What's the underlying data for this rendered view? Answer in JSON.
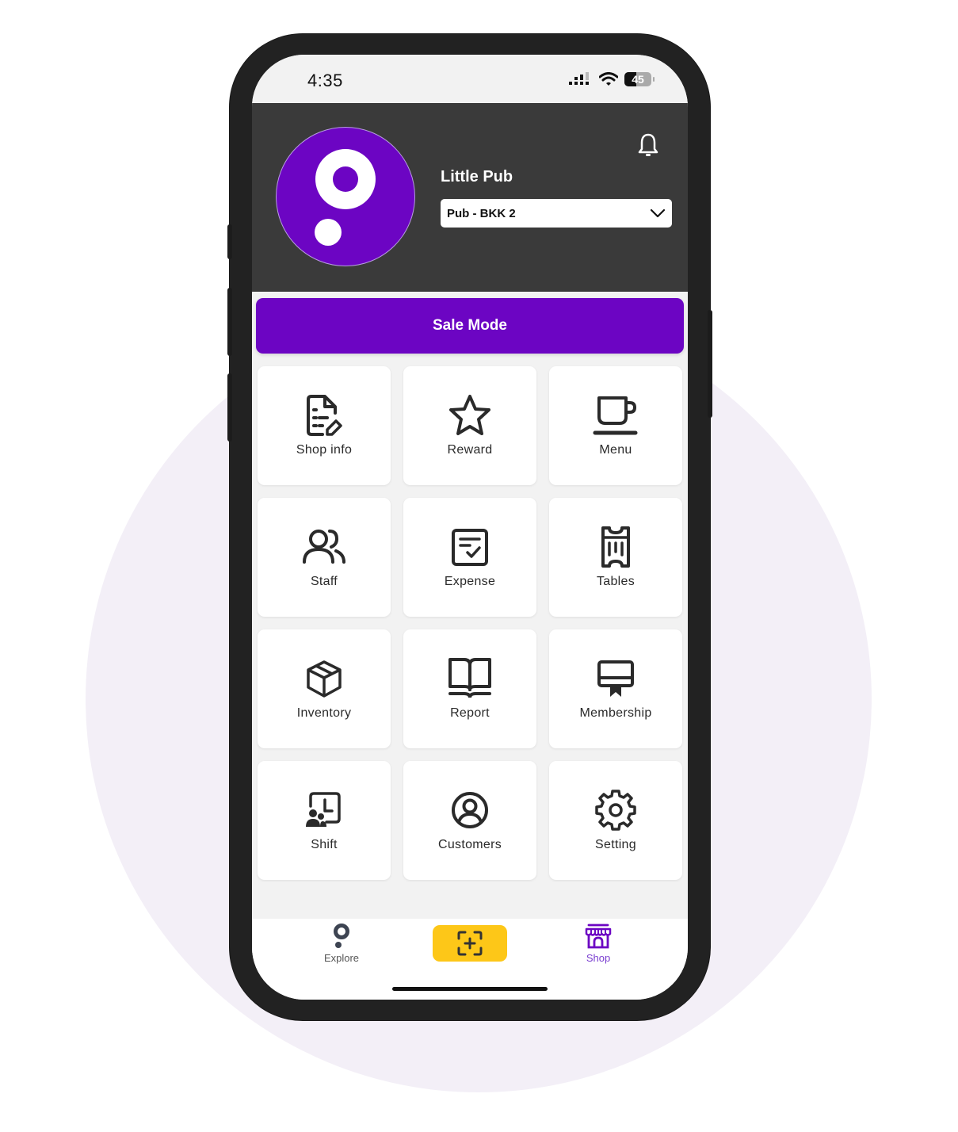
{
  "status_bar": {
    "time": "4:35",
    "battery_level": "45",
    "icons": [
      "cellular-signal-icon",
      "wifi-icon",
      "battery-icon"
    ]
  },
  "header": {
    "shop_name": "Little Pub",
    "branch_selected": "Pub - BKK 2",
    "logo_icon": "pin-logo-icon",
    "notification_icon": "bell-icon"
  },
  "sale_mode": {
    "label": "Sale Mode"
  },
  "menu_tiles": [
    {
      "label": "Shop info",
      "icon": "document-edit-icon"
    },
    {
      "label": "Reward",
      "icon": "star-icon"
    },
    {
      "label": "Menu",
      "icon": "coffee-cup-icon"
    },
    {
      "label": "Staff",
      "icon": "users-icon"
    },
    {
      "label": "Expense",
      "icon": "checklist-icon"
    },
    {
      "label": "Tables",
      "icon": "ticket-icon"
    },
    {
      "label": "Inventory",
      "icon": "box-icon"
    },
    {
      "label": "Report",
      "icon": "open-book-icon"
    },
    {
      "label": "Membership",
      "icon": "membership-card-icon"
    },
    {
      "label": "Shift",
      "icon": "shift-clock-icon"
    },
    {
      "label": "Customers",
      "icon": "user-circle-icon"
    },
    {
      "label": "Setting",
      "icon": "gear-icon"
    }
  ],
  "tab_bar": {
    "tabs": [
      {
        "label": "Explore",
        "icon": "pin-icon",
        "active": false
      },
      {
        "label": "",
        "icon": "scan-plus-icon",
        "active": false
      },
      {
        "label": "Shop",
        "icon": "storefront-icon",
        "active": true
      }
    ]
  },
  "colors": {
    "brand_purple": "#6c05c3",
    "header_bg": "#3a3a3a",
    "scan_yellow": "#fdc718",
    "active_tab": "#7a3ed0",
    "screen_bg": "#f2f2f2"
  }
}
